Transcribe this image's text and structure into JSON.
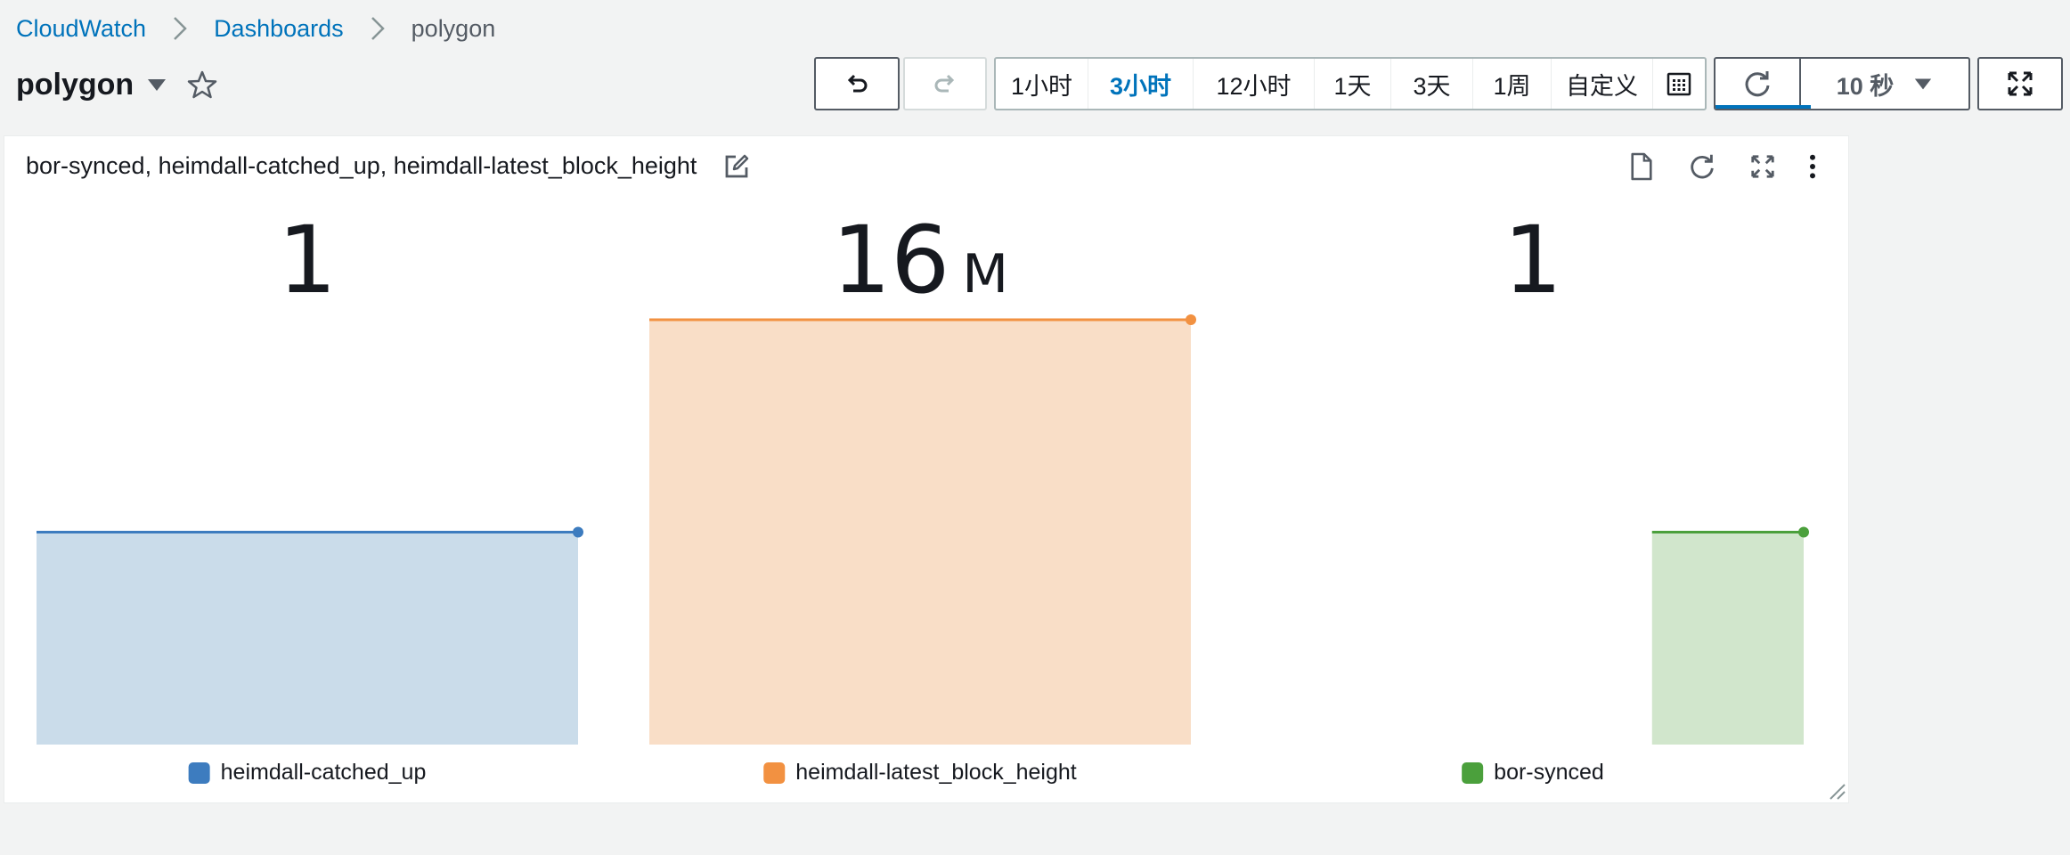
{
  "breadcrumb": {
    "items": [
      "CloudWatch",
      "Dashboards"
    ],
    "current": "polygon"
  },
  "dashboard": {
    "title": "polygon"
  },
  "time_range": {
    "options": [
      "1小时",
      "3小时",
      "12小时",
      "1天",
      "3天",
      "1周",
      "自定义"
    ],
    "active": "3小时"
  },
  "refresh": {
    "interval_label": "10 秒",
    "progress_fraction": 0.38
  },
  "widget": {
    "title": "bor-synced, heimdall-catched_up, heimdall-latest_block_height",
    "metrics": [
      {
        "name": "heimdall-catched_up",
        "value": "1",
        "unit": "",
        "color": "#3d7cbf",
        "fill": "#cadcea",
        "level": 0.5,
        "start": 0.0
      },
      {
        "name": "heimdall-latest_block_height",
        "value": "16",
        "unit": "M",
        "color": "#f29141",
        "fill": "#f9dec7",
        "level": 1.0,
        "start": 0.0
      },
      {
        "name": "bor-synced",
        "value": "1",
        "unit": "",
        "color": "#4ba03c",
        "fill": "#d1e6cc",
        "level": 0.5,
        "start": 0.72
      }
    ]
  },
  "colors": {
    "link": "#0073bb",
    "accent": "#0073bb"
  }
}
